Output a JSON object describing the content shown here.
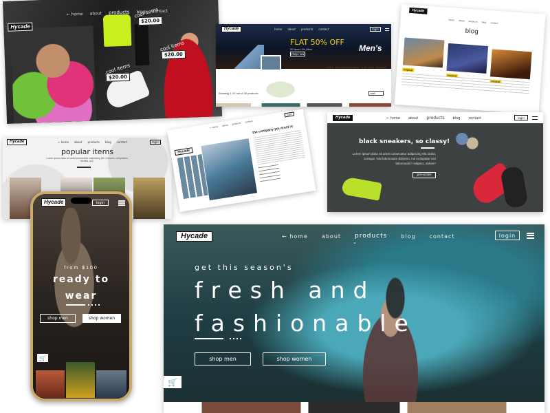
{
  "brand": {
    "logo": "Hycade"
  },
  "nav": {
    "home": "home",
    "about": "about",
    "products": "products",
    "blog": "blog",
    "contact": "contact",
    "login": "login",
    "home_arrow": "← home"
  },
  "card1": {
    "items": [
      {
        "label": "cool items",
        "price": "$20.00"
      },
      {
        "label": "cool items",
        "price": "$20.00"
      },
      {
        "label": "cool items",
        "price": "$20.00"
      }
    ]
  },
  "card2": {
    "promo": "FLAT 50% OFF",
    "promo_sub": "50 Items 2% Mins",
    "shop_now": "shop now",
    "category": "Men's",
    "tagline": "fresh and fashionable look with hycade",
    "showing": "Showing 1-12 out of 30 products",
    "sort": "sort"
  },
  "card3": {
    "title": "blog",
    "post_tag": "tropical"
  },
  "card4": {
    "title": "popular items",
    "subtitle": "Lorem ipsum dolor sit amet consectetur adipisicing elit. Dolorem, voluptatem. Mollitia, quo."
  },
  "card5": {
    "heading": "the company you trust in"
  },
  "card6": {
    "heading": "black sneakers, so classy!",
    "body": "Lorem ipsum dolor sit amet consectetur adipiscing elit. Dolor, cumque. Nisi laboriosam dolorem, non voluptate non laboriosam? Adipisci, dolore?",
    "preorder": "pre-order"
  },
  "phone": {
    "from": "from $100",
    "headline1": "ready to",
    "headline2": "wear",
    "shop_men": "shop men",
    "shop_women": "shop women"
  },
  "hero": {
    "pretitle": "get this season's",
    "title1": "fresh and",
    "title2": "fashionable",
    "shop_men": "shop men",
    "shop_women": "shop women"
  },
  "colors": {
    "accent_yellow": "#f5d000",
    "dark": "#111111",
    "teal": "#2a8a8a"
  }
}
